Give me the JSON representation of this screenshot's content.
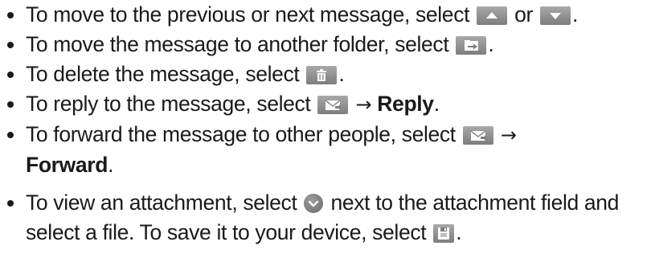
{
  "items": [
    {
      "pre": "To move to the previous or next message, select ",
      "mid": " or ",
      "post": "."
    },
    {
      "pre": "To move the message to another folder, select ",
      "post": "."
    },
    {
      "pre": "To delete the message, select ",
      "post": "."
    },
    {
      "pre": "To reply to the message, select ",
      "arrow": "→",
      "bold": "Reply",
      "post": "."
    },
    {
      "pre": "To forward the message to other people, select ",
      "arrow": "→",
      "bold": "Forward",
      "post": "."
    },
    {
      "pre": "To view an attachment, select ",
      "mid": " next to the attachment field and select a file. To save it to your device, select ",
      "post": "."
    }
  ],
  "icons": {
    "up": "up-arrow-icon",
    "down": "down-arrow-icon",
    "move": "move-folder-icon",
    "delete": "trash-icon",
    "reply": "envelope-reply-icon",
    "forward": "envelope-forward-icon",
    "expand": "chevron-down-circle-icon",
    "save": "save-icon"
  },
  "colors": {
    "text": "#1a1a1a",
    "icon_bg": "#8f8f8f",
    "icon_fg": "#ffffff"
  }
}
